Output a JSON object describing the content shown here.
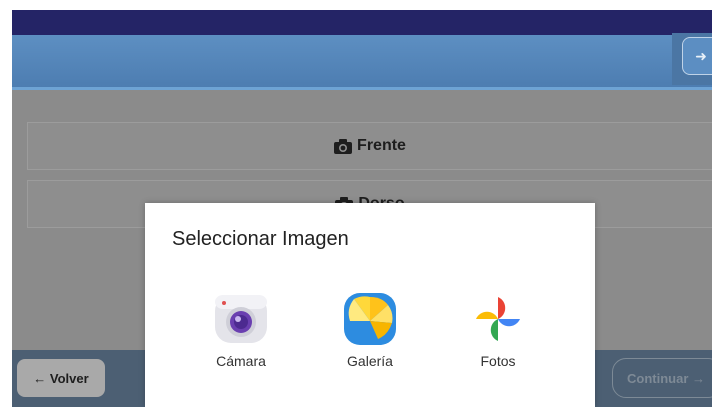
{
  "header": {
    "exit_icon": "sign-out-icon"
  },
  "photo_buttons": [
    {
      "label": "Frente",
      "icon": "camera-icon"
    },
    {
      "label": "Dorso",
      "icon": "camera-icon"
    }
  ],
  "footer": {
    "back_label": "← Volver",
    "continue_label": "Continuar →"
  },
  "dialog": {
    "title": "Seleccionar Imagen",
    "apps": [
      {
        "label": "Cámara",
        "icon": "camera-app-icon"
      },
      {
        "label": "Galería",
        "icon": "gallery-app-icon"
      },
      {
        "label": "Fotos",
        "icon": "photos-app-icon"
      }
    ]
  },
  "colors": {
    "status_bar": "#242466",
    "app_bar": "#4d7db1",
    "footer": "#4c5f73"
  }
}
